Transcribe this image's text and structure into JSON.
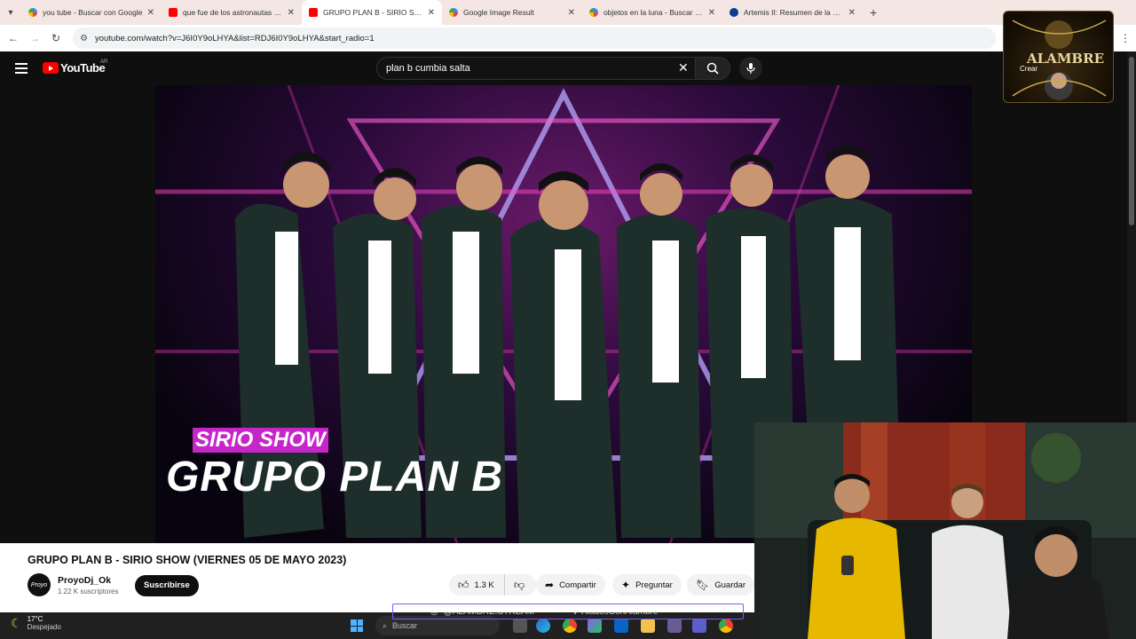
{
  "browser": {
    "tabs": [
      {
        "title": "you tube - Buscar con Google",
        "icon": "google-icon",
        "active": false
      },
      {
        "title": "que fue de los astronautas que",
        "icon": "youtube-icon",
        "active": false
      },
      {
        "title": "GRUPO PLAN B - SIRIO SHOW",
        "icon": "youtube-icon",
        "active": true
      },
      {
        "title": "Google Image Result",
        "icon": "google-icon",
        "active": false
      },
      {
        "title": "objetos en la luna - Buscar con",
        "icon": "google-icon",
        "active": false
      },
      {
        "title": "Artemis II: Resumen de la misió",
        "icon": "nasa-icon",
        "active": false
      }
    ],
    "url": "youtube.com/watch?v=J6I0Y9oLHYA&list=RDJ6I0Y9oLHYA&start_radio=1"
  },
  "youtube": {
    "logo_text": "YouTube",
    "country_code": "AR",
    "search_query": "plan b cumbia salta"
  },
  "video": {
    "overlay_subtitle": "SIRIO SHOW",
    "overlay_title": "GRUPO PLAN B",
    "title": "GRUPO PLAN B - SIRIO SHOW (VIERNES 05 DE MAYO 2023)",
    "channel_name": "ProyoDj_Ok",
    "channel_avatar_text": "Proyo",
    "subscribers": "1.22 K suscriptores",
    "subscribe_label": "Suscribirse",
    "likes": "1.3 K",
    "share_label": "Compartir",
    "ask_label": "Preguntar",
    "save_label": "Guardar"
  },
  "stream": {
    "handle_left": "@ALAMBRE.STREAM",
    "handle_right": "AladosConAlambre",
    "logo_text": "ALAMBRE",
    "logo_sub": "Crear"
  },
  "taskbar": {
    "temperature": "17°C",
    "weather": "Despejado",
    "search_placeholder": "Buscar"
  },
  "colors": {
    "youtube_red": "#ff0000",
    "overlay_magenta": "#c626c9",
    "stream_border": "#7a5cff"
  }
}
